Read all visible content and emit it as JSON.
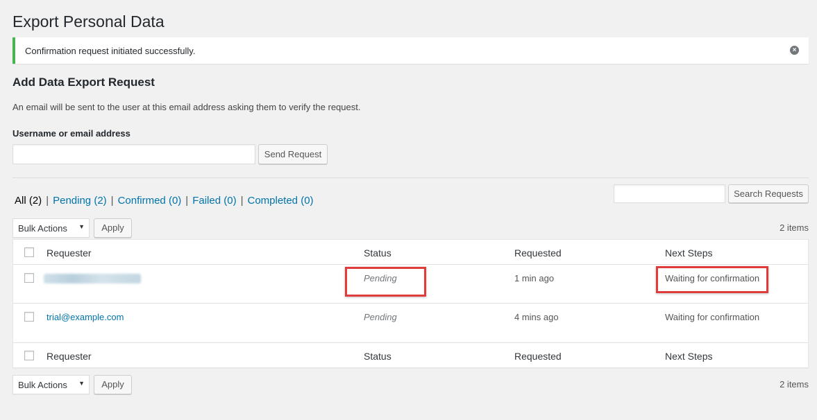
{
  "page": {
    "title": "Export Personal Data"
  },
  "notice": {
    "message": "Confirmation request initiated successfully.",
    "dismiss_icon": "dismiss-icon",
    "accent": "#46b450"
  },
  "form": {
    "heading": "Add Data Export Request",
    "description": "An email will be sent to the user at this email address asking them to verify the request.",
    "field_label": "Username or email address",
    "field_value": "",
    "submit_label": "Send Request"
  },
  "filters": [
    {
      "label": "All",
      "count": "(2)",
      "current": true
    },
    {
      "label": "Pending",
      "count": "(2)",
      "current": false
    },
    {
      "label": "Confirmed",
      "count": "(0)",
      "current": false
    },
    {
      "label": "Failed",
      "count": "(0)",
      "current": false
    },
    {
      "label": "Completed",
      "count": "(0)",
      "current": false
    }
  ],
  "search": {
    "value": "",
    "button_label": "Search Requests"
  },
  "bulk": {
    "selected": "Bulk Actions",
    "apply_label": "Apply"
  },
  "items_count": "2 items",
  "table": {
    "columns": [
      "Requester",
      "Status",
      "Requested",
      "Next Steps"
    ],
    "rows": [
      {
        "requester": "",
        "status": "Pending",
        "requested": "1 min ago",
        "next_steps": "Waiting for confirmation"
      },
      {
        "requester": "trial@example.com",
        "status": "Pending",
        "requested": "4 mins ago",
        "next_steps": "Waiting for confirmation"
      }
    ]
  },
  "colors": {
    "link": "#0073aa",
    "highlight": "#e03c3c"
  }
}
